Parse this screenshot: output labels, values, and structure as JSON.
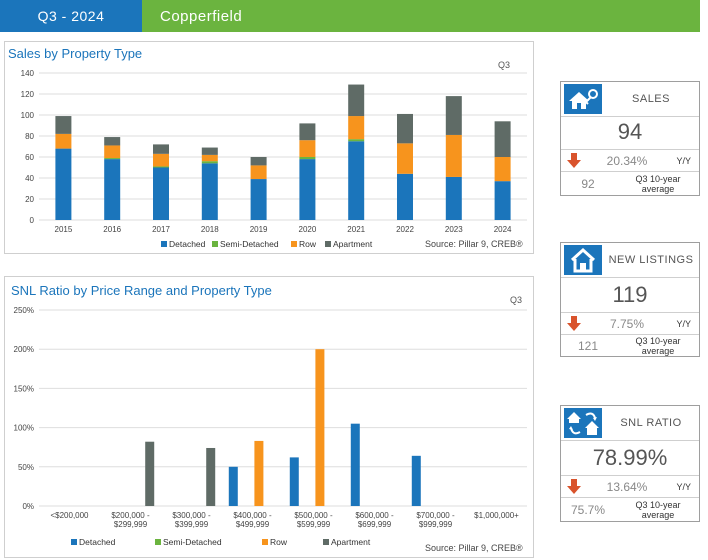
{
  "header": {
    "period": "Q3 - 2024",
    "area": "Copperfield"
  },
  "sales_chart": {
    "title": "Sales by Property Type",
    "tag": "Q3",
    "source": "Source: Pillar 9, CREB®"
  },
  "snl_chart": {
    "title": "SNL Ratio by Price Range and Property Type",
    "tag": "Q3",
    "source": "Source: Pillar 9, CREB®"
  },
  "chart_data": [
    {
      "type": "bar",
      "stacked": true,
      "title": "Sales by Property Type",
      "categories": [
        "2015",
        "2016",
        "2017",
        "2018",
        "2019",
        "2020",
        "2021",
        "2022",
        "2023",
        "2024"
      ],
      "ylim": [
        0,
        140
      ],
      "yticks": [
        "0",
        "20",
        "40",
        "60",
        "80",
        "100",
        "120",
        "140"
      ],
      "series": [
        {
          "name": "Detached",
          "color": "#1b75bb",
          "values": [
            68,
            58,
            50,
            54,
            39,
            58,
            75,
            44,
            41,
            37
          ]
        },
        {
          "name": "Semi-Detached",
          "color": "#6bb43f",
          "values": [
            0,
            1,
            1,
            2,
            0,
            2,
            2,
            0,
            0,
            0
          ]
        },
        {
          "name": "Row",
          "color": "#f7941d",
          "values": [
            14,
            12,
            12,
            6,
            13,
            16,
            22,
            29,
            40,
            23
          ]
        },
        {
          "name": "Apartment",
          "color": "#5f6b66",
          "values": [
            17,
            8,
            9,
            7,
            8,
            16,
            30,
            28,
            37,
            34
          ]
        }
      ],
      "grid": true,
      "legend": "bottom"
    },
    {
      "type": "bar",
      "stacked": false,
      "title": "SNL Ratio by Price Range and Property Type",
      "categories": [
        "<$200,000",
        "$200,000 -\n$299,999",
        "$300,000 -\n$399,999",
        "$400,000 -\n$499,999",
        "$500,000 -\n$599,999",
        "$600,000 -\n$699,999",
        "$700,000 -\n$999,999",
        "$1,000,000+"
      ],
      "ylim": [
        0,
        250
      ],
      "yticks": [
        "0%",
        "50%",
        "100%",
        "150%",
        "200%",
        "250%"
      ],
      "series": [
        {
          "name": "Detached",
          "color": "#1b75bb",
          "values": [
            null,
            null,
            null,
            50,
            62,
            105,
            64,
            null
          ]
        },
        {
          "name": "Semi-Detached",
          "color": "#6bb43f",
          "values": [
            null,
            null,
            null,
            null,
            null,
            null,
            null,
            null
          ]
        },
        {
          "name": "Row",
          "color": "#f7941d",
          "values": [
            null,
            null,
            null,
            83,
            200,
            null,
            null,
            null
          ]
        },
        {
          "name": "Apartment",
          "color": "#5f6b66",
          "values": [
            null,
            82,
            74,
            null,
            null,
            null,
            null,
            null
          ]
        }
      ],
      "grid": true,
      "legend": "bottom"
    }
  ],
  "cards": [
    {
      "label": "SALES",
      "value": "94",
      "change": "20.34%",
      "yy": "Y/Y",
      "ten_year": "92",
      "ten_year_label_1": "Q3 10-year",
      "ten_year_label_2": "average",
      "icon": "house-key-icon"
    },
    {
      "label": "NEW LISTINGS",
      "value": "119",
      "change": "7.75%",
      "yy": "Y/Y",
      "ten_year": "121",
      "ten_year_label_1": "Q3 10-year",
      "ten_year_label_2": "average",
      "icon": "house-icon"
    },
    {
      "label": "SNL RATIO",
      "value": "78.99%",
      "change": "13.64%",
      "yy": "Y/Y",
      "ten_year": "75.7%",
      "ten_year_label_1": "Q3 10-year",
      "ten_year_label_2": "average",
      "icon": "houses-exchange-icon"
    }
  ]
}
